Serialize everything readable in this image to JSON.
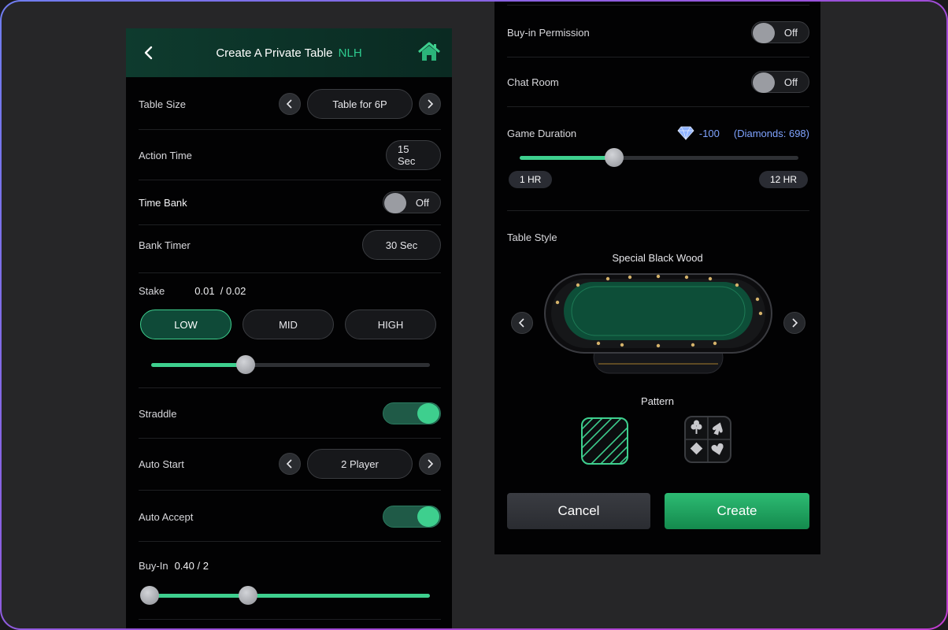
{
  "left": {
    "header": {
      "title": "Create A Private Table",
      "title_accent": "NLH"
    },
    "table_size": {
      "label": "Table Size",
      "value": "Table for 6P"
    },
    "action_time": {
      "label": "Action Time",
      "value": "15 Sec"
    },
    "time_bank": {
      "label": "Time Bank",
      "state": "Off"
    },
    "bank_timer": {
      "label": "Bank Timer",
      "value": "30 Sec"
    },
    "stake": {
      "label": "Stake",
      "value": "0.01  / 0.02",
      "levels": [
        "LOW",
        "MID",
        "HIGH"
      ],
      "selected": "LOW",
      "slider_fraction": 0.34
    },
    "straddle": {
      "label": "Straddle",
      "state": "on"
    },
    "auto_start": {
      "label": "Auto Start",
      "value": "2 Player"
    },
    "auto_accept": {
      "label": "Auto Accept",
      "state": "on"
    },
    "buy_in": {
      "label": "Buy-In",
      "value": "0.40 / 2",
      "range_min_fraction": 0.0,
      "range_max_fraction": 0.35
    }
  },
  "right": {
    "buyin_permission": {
      "label": "Buy-in Permission",
      "state": "Off"
    },
    "chat_room": {
      "label": "Chat Room",
      "state": "Off"
    },
    "game_duration": {
      "label": "Game Duration",
      "cost": "-100",
      "diamonds": "(Diamonds: 698)",
      "min_tag": "1 HR",
      "max_tag": "12 HR",
      "slider_fraction": 0.34
    },
    "table_style": {
      "label": "Table Style",
      "name": "Special Black Wood"
    },
    "pattern": {
      "label": "Pattern"
    },
    "actions": {
      "cancel": "Cancel",
      "create": "Create"
    }
  },
  "colors": {
    "accent": "#3ecf8e",
    "header_bg": "#0e3b2e",
    "diamond_text": "#7fa3ff",
    "create_btn": "#1fa862"
  },
  "icons": [
    "chevron-left-icon",
    "home-icon",
    "chevron-right-icon",
    "diamond-icon",
    "diagonal-stripes-pattern",
    "card-suits-pattern"
  ]
}
